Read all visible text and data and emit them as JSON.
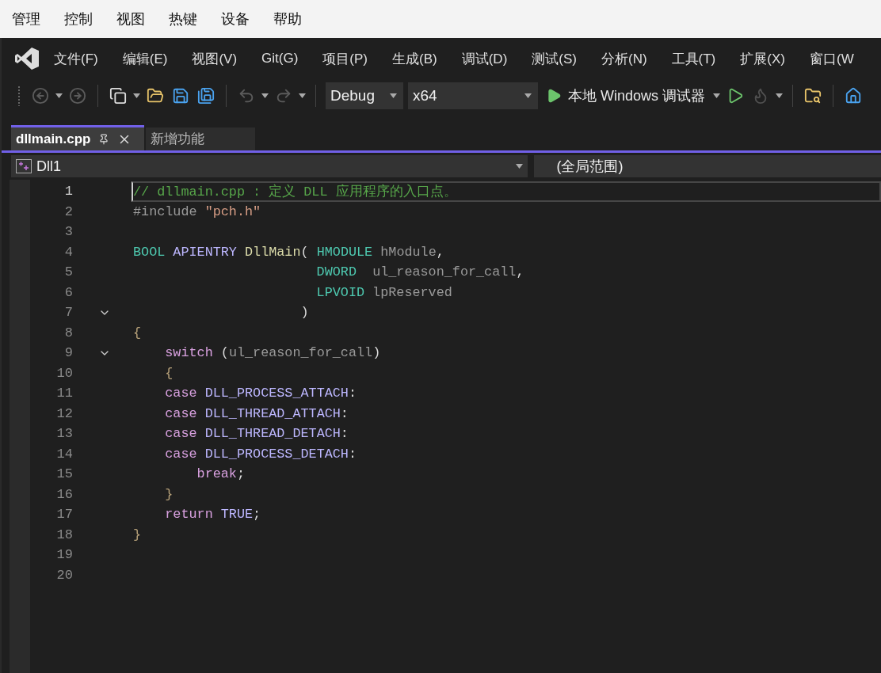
{
  "host_menu": [
    "管理",
    "控制",
    "视图",
    "热键",
    "设备",
    "帮助"
  ],
  "menu": [
    "文件(F)",
    "编辑(E)",
    "视图(V)",
    "Git(G)",
    "项目(P)",
    "生成(B)",
    "调试(D)",
    "测试(S)",
    "分析(N)",
    "工具(T)",
    "扩展(X)",
    "窗口(W"
  ],
  "toolbar": {
    "items": [
      {
        "kind": "back",
        "disabled": true
      },
      {
        "kind": "forward",
        "disabled": true
      },
      {
        "kind": "new-project",
        "disabled": false
      },
      {
        "kind": "open",
        "disabled": false
      },
      {
        "kind": "save",
        "disabled": false
      },
      {
        "kind": "save-all",
        "disabled": false
      },
      {
        "kind": "undo",
        "disabled": true
      },
      {
        "kind": "redo",
        "disabled": true
      },
      {
        "kind": "config",
        "value": "Debug"
      },
      {
        "kind": "platform",
        "value": "x64"
      },
      {
        "kind": "run",
        "label": "本地 Windows 调试器",
        "disabled": false
      },
      {
        "kind": "run-without-debug",
        "disabled": false
      },
      {
        "kind": "hot-reload",
        "disabled": true
      },
      {
        "kind": "find-files",
        "disabled": false
      },
      {
        "kind": "cut-off",
        "disabled": false
      }
    ]
  },
  "tabs": [
    {
      "label": "dllmain.cpp",
      "selected": true
    },
    {
      "label": "新增功能",
      "selected": false
    }
  ],
  "nav": {
    "project": "Dll1",
    "scope": "(全局范围)"
  },
  "editor": {
    "lines": [
      {
        "number": "1",
        "current": true,
        "tokens": [
          {
            "kind": "comment",
            "text": "// dllmain.cpp : 定义 DLL 应用程序的入口点。"
          }
        ]
      },
      {
        "number": "2",
        "current": false,
        "tokens": [
          {
            "kind": "preproc",
            "text": "#include "
          },
          {
            "kind": "string",
            "text": "\"pch.h\""
          }
        ]
      },
      {
        "number": "3",
        "current": false
      },
      {
        "number": "4",
        "current": false,
        "tokens": [
          {
            "kind": "type",
            "text": "BOOL"
          },
          {
            "kind": "macro",
            "text": " APIENTRY"
          },
          {
            "kind": "func",
            "text": " DllMain"
          },
          {
            "kind": "plain",
            "text": "( "
          },
          {
            "kind": "type",
            "text": "HMODULE"
          },
          {
            "kind": "param",
            "text": " hModule"
          },
          {
            "kind": "plain",
            "text": ","
          }
        ]
      },
      {
        "number": "5",
        "current": false,
        "tokens": [
          {
            "kind": "type",
            "text": "                       DWORD"
          },
          {
            "kind": "param",
            "text": "  ul_reason_for_call"
          },
          {
            "kind": "plain",
            "text": ","
          }
        ]
      },
      {
        "number": "6",
        "current": false,
        "tokens": [
          {
            "kind": "type",
            "text": "                       LPVOID"
          },
          {
            "kind": "param",
            "text": " lpReserved"
          }
        ]
      },
      {
        "number": "7",
        "current": false,
        "expanded": true,
        "tokens": [
          {
            "kind": "plain",
            "text": "                     )"
          }
        ]
      },
      {
        "number": "8",
        "current": false,
        "tokens": [
          {
            "kind": "brace",
            "text": "{"
          }
        ]
      },
      {
        "number": "9",
        "current": false,
        "expanded": true,
        "tokens": [
          {
            "kind": "control",
            "text": "    switch"
          },
          {
            "kind": "plain",
            "text": " ("
          },
          {
            "kind": "param",
            "text": "ul_reason_for_call"
          },
          {
            "kind": "plain",
            "text": ")"
          }
        ]
      },
      {
        "number": "10",
        "current": false,
        "tokens": [
          {
            "kind": "brace",
            "text": "    {"
          }
        ]
      },
      {
        "number": "11",
        "current": false,
        "tokens": [
          {
            "kind": "control",
            "text": "    case"
          },
          {
            "kind": "macro",
            "text": " DLL_PROCESS_ATTACH"
          },
          {
            "kind": "plain",
            "text": ":"
          }
        ]
      },
      {
        "number": "12",
        "current": false,
        "tokens": [
          {
            "kind": "control",
            "text": "    case"
          },
          {
            "kind": "macro",
            "text": " DLL_THREAD_ATTACH"
          },
          {
            "kind": "plain",
            "text": ":"
          }
        ]
      },
      {
        "number": "13",
        "current": false,
        "tokens": [
          {
            "kind": "control",
            "text": "    case"
          },
          {
            "kind": "macro",
            "text": " DLL_THREAD_DETACH"
          },
          {
            "kind": "plain",
            "text": ":"
          }
        ]
      },
      {
        "number": "14",
        "current": false,
        "tokens": [
          {
            "kind": "control",
            "text": "    case"
          },
          {
            "kind": "macro",
            "text": " DLL_PROCESS_DETACH"
          },
          {
            "kind": "plain",
            "text": ":"
          }
        ]
      },
      {
        "number": "15",
        "current": false,
        "tokens": [
          {
            "kind": "control",
            "text": "        break"
          },
          {
            "kind": "plain",
            "text": ";"
          }
        ]
      },
      {
        "number": "16",
        "current": false,
        "tokens": [
          {
            "kind": "brace",
            "text": "    }"
          }
        ]
      },
      {
        "number": "17",
        "current": false,
        "tokens": [
          {
            "kind": "control",
            "text": "    return"
          },
          {
            "kind": "macro",
            "text": " TRUE"
          },
          {
            "kind": "plain",
            "text": ";"
          }
        ]
      },
      {
        "number": "18",
        "current": false,
        "tokens": [
          {
            "kind": "brace",
            "text": "}"
          }
        ]
      },
      {
        "number": "19",
        "current": false
      },
      {
        "number": "20",
        "current": false
      }
    ]
  }
}
